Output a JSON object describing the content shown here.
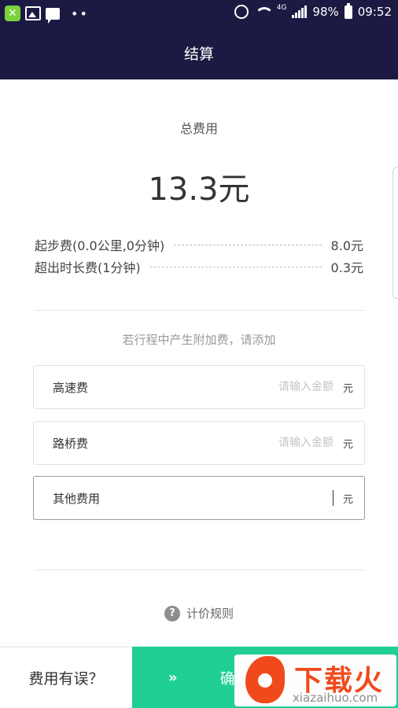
{
  "status_bar": {
    "battery": "98%",
    "time": "09:52",
    "network": "4G",
    "app_badge": "✕"
  },
  "header": {
    "title": "结算"
  },
  "summary": {
    "total_label": "总费用",
    "total_amount": "13.3元"
  },
  "fees": [
    {
      "name": "起步费(0.0公里,0分钟)",
      "value": "8.0元"
    },
    {
      "name": "超出时长费(1分钟)",
      "value": "0.3元"
    }
  ],
  "extra": {
    "hint": "若行程中产生附加费，请添加",
    "fields": [
      {
        "label": "高速费",
        "placeholder": "请输入金额",
        "value": "",
        "unit": "元"
      },
      {
        "label": "路桥费",
        "placeholder": "请输入金额",
        "value": "",
        "unit": "元"
      },
      {
        "label": "其他费用",
        "placeholder": "",
        "value": "",
        "unit": "元"
      }
    ]
  },
  "rules": {
    "icon": "?",
    "label": "计价规则"
  },
  "bottom_bar": {
    "error_label": "费用有误？",
    "confirm_arrows": "»",
    "confirm_label": "确"
  },
  "watermark": {
    "text": "下载火",
    "url": "xiazaihuo.com"
  },
  "colors": {
    "header_bg": "#1c1a43",
    "confirm_bg": "#1fcf96",
    "watermark_red": "#f04a1c"
  }
}
